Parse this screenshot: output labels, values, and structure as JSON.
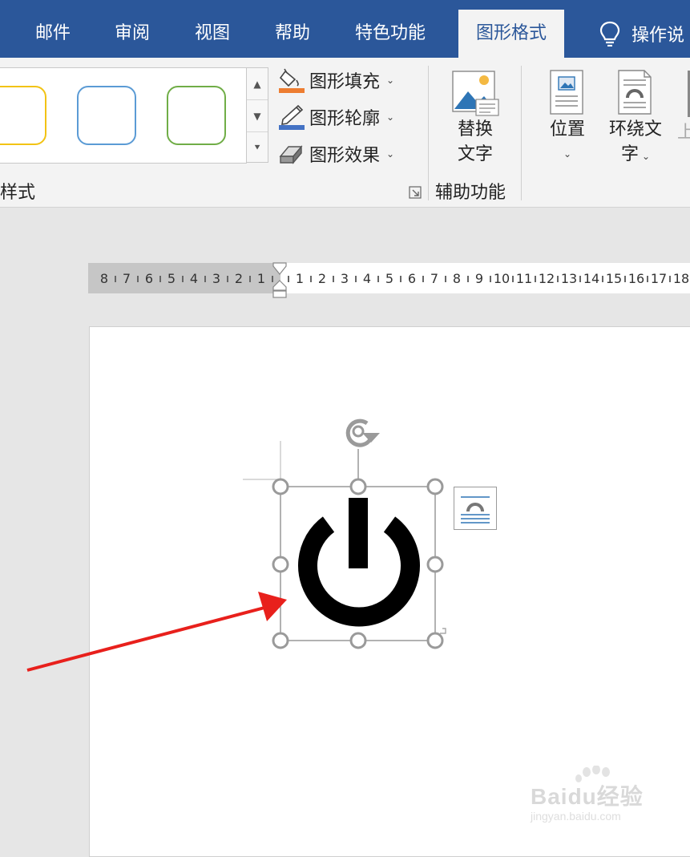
{
  "tabs": [
    {
      "label": "邮件"
    },
    {
      "label": "审阅"
    },
    {
      "label": "视图"
    },
    {
      "label": "帮助"
    },
    {
      "label": "特色功能"
    },
    {
      "label": "图形格式",
      "active": true
    },
    {
      "label": "操作说"
    }
  ],
  "ribbon": {
    "styles_group_label": "样式",
    "gallery": [
      {
        "color": "#f2c314"
      },
      {
        "color": "#5b9bd5"
      },
      {
        "color": "#70ad47"
      }
    ],
    "commands": {
      "fill": "图形填充",
      "outline": "图形轮廓",
      "effects": "图形效果"
    },
    "alt_text_line1": "替换",
    "alt_text_line2": "文字",
    "accessibility_group_label": "辅助功能",
    "position_label": "位置",
    "wrap_text_line1": "环绕文",
    "wrap_text_line2": "字",
    "bring_forward_partial": "上"
  },
  "ruler": {
    "left_numbers": [
      "8",
      "7",
      "6",
      "5",
      "4",
      "3",
      "2",
      "1"
    ],
    "right_numbers": [
      "1",
      "2",
      "3",
      "4",
      "5",
      "6",
      "7",
      "8",
      "9",
      "10",
      "11",
      "12",
      "13",
      "14",
      "15",
      "16",
      "17",
      "18"
    ]
  },
  "watermark": {
    "brand": "Baidu经验",
    "url": "jingyan.baidu.com"
  },
  "colors": {
    "tab_bar": "#2b579a",
    "ribbon_bg": "#f3f3f3",
    "arrow": "#e8201c",
    "icon": "#000000"
  },
  "icons": [
    "lightbulb-icon",
    "paint-bucket-icon",
    "pen-outline-icon",
    "shape-effects-icon",
    "alt-text-icon",
    "position-icon",
    "wrap-text-icon",
    "power-icon",
    "rotate-handle-icon",
    "layout-options-icon"
  ]
}
